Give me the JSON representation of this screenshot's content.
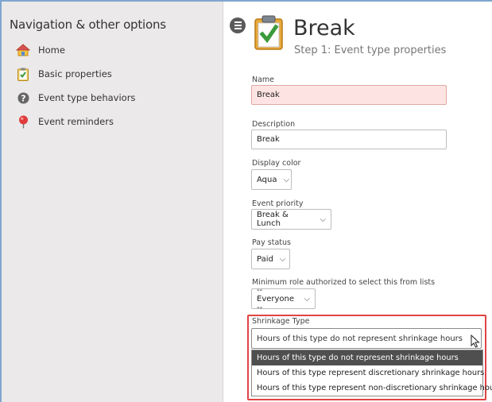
{
  "sidebar": {
    "title": "Navigation & other options",
    "items": [
      {
        "label": "Home",
        "icon": "home-icon"
      },
      {
        "label": "Basic properties",
        "icon": "clipboard-check-icon"
      },
      {
        "label": "Event type behaviors",
        "icon": "question-circle-icon"
      },
      {
        "label": "Event reminders",
        "icon": "pushpin-icon"
      }
    ]
  },
  "header": {
    "title": "Break",
    "subtitle": "Step 1: Event type properties",
    "icon": "clipboard-check-icon"
  },
  "form": {
    "name_label": "Name",
    "name_value": "Break",
    "description_label": "Description",
    "description_value": "Break",
    "display_color_label": "Display color",
    "display_color_value": "Aqua",
    "event_priority_label": "Event priority",
    "event_priority_value": "Break & Lunch",
    "pay_status_label": "Pay status",
    "pay_status_value": "Paid",
    "min_role_label": "Minimum role authorized to select this from lists",
    "min_role_value": "-- Everyone --",
    "shrinkage_label": "Shrinkage Type",
    "shrinkage_value": "Hours of this type do not represent shrinkage hours",
    "shrinkage_options": [
      "Hours of this type do not represent shrinkage hours",
      "Hours of this type represent discretionary shrinkage hours",
      "Hours of this type represent non-discretionary shrinkage hours"
    ]
  },
  "colors": {
    "sidebar_bg": "#ebe9e9",
    "required_field_bg": "#fde4e2",
    "highlight_border": "#e04444",
    "selected_option_bg": "#4f4f4f"
  }
}
